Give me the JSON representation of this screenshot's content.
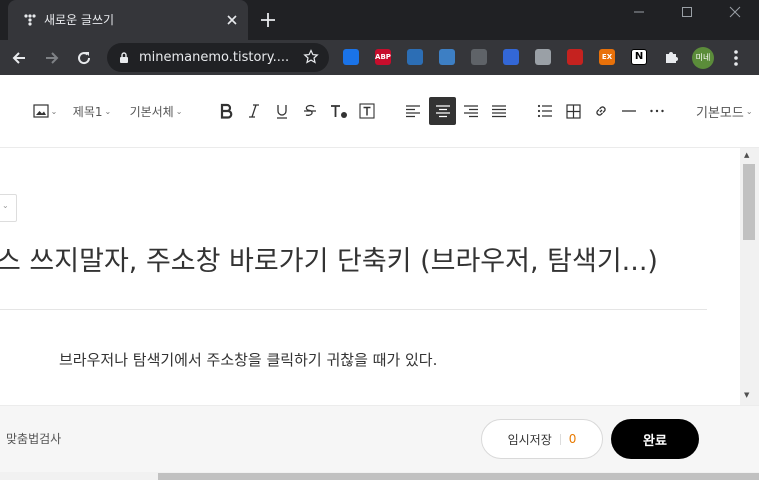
{
  "browser": {
    "tab_title": "새로운 글쓰기",
    "url": "minemanemo.tistory....",
    "profile_initials": "미네",
    "extensions": [
      {
        "name": "feather-extension-icon",
        "color": "#1a73e8",
        "label": ""
      },
      {
        "name": "abp-extension-icon",
        "color": "#c70d2c",
        "label": "ABP"
      },
      {
        "name": "translate-extension-icon",
        "color": "#2c6eb5",
        "label": ""
      },
      {
        "name": "circle-extension-icon",
        "color": "#3d7fc4",
        "label": ""
      },
      {
        "name": "monitor-extension-icon",
        "color": "#5f6368",
        "label": ""
      },
      {
        "name": "book-extension-icon",
        "color": "#3367d6",
        "label": ""
      },
      {
        "name": "camera-extension-icon",
        "color": "#9aa0a6",
        "label": ""
      },
      {
        "name": "bookmark-extension-icon",
        "color": "#c5221f",
        "label": ""
      },
      {
        "name": "ex-extension-icon",
        "color": "#e8710a",
        "label": "EX"
      },
      {
        "name": "notion-extension-icon",
        "color": "#ffffff",
        "label": "N"
      }
    ]
  },
  "editor_toolbar": {
    "heading": "제목1",
    "font": "기본서체",
    "mode": "기본모드"
  },
  "post": {
    "title": "스 쓰지말자, 주소창 바로가기 단축키 (브라우저, 탐색기...)",
    "body": "브라우저나 탐색기에서 주소창을 클릭하기 귀찮을 때가 있다."
  },
  "footer": {
    "spellcheck": "맞춤법검사",
    "draft_label": "임시저장",
    "draft_count": "0",
    "done_label": "완료"
  },
  "colors": {
    "accent_orange": "#e87a00",
    "chrome_dark": "#202124",
    "chrome_tab": "#35363a"
  }
}
